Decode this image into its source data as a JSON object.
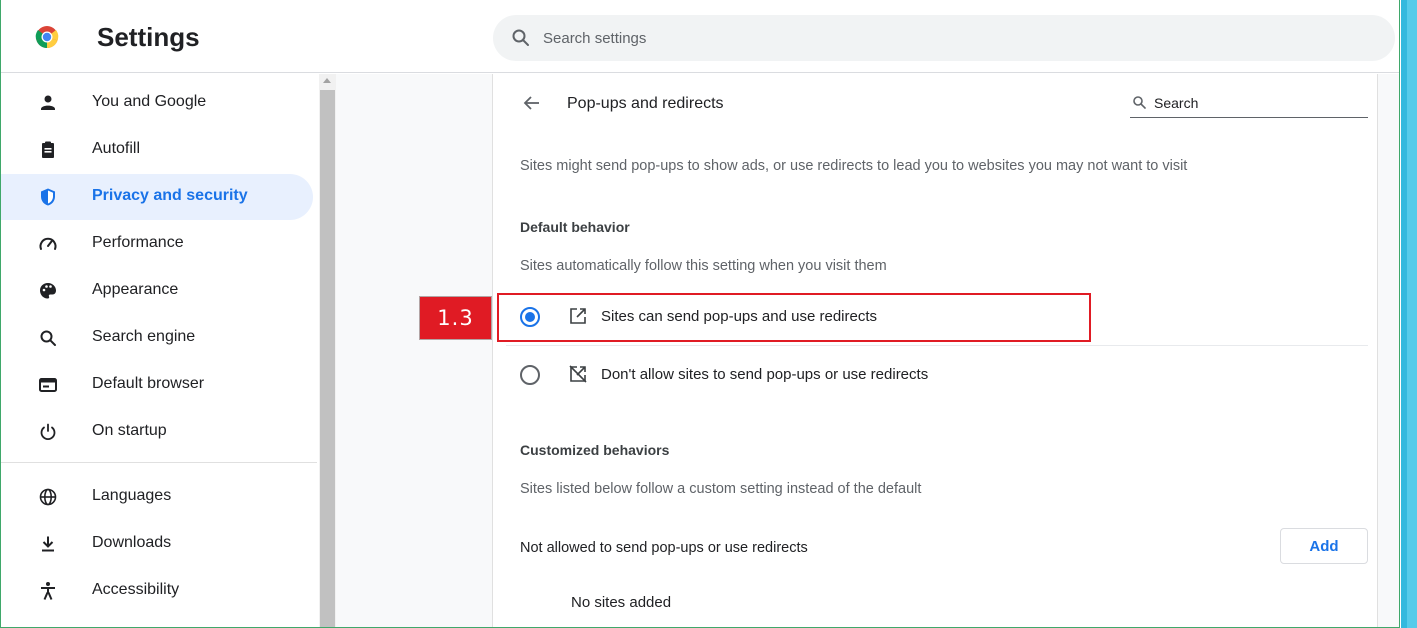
{
  "header": {
    "app_title": "Settings",
    "search_placeholder": "Search settings",
    "logo_icon": "chrome-logo-icon"
  },
  "sidebar": {
    "items": [
      {
        "label": "You and Google",
        "icon": "person-icon",
        "active": false
      },
      {
        "label": "Autofill",
        "icon": "clipboard-icon",
        "active": false
      },
      {
        "label": "Privacy and security",
        "icon": "shield-icon",
        "active": true
      },
      {
        "label": "Performance",
        "icon": "speedometer-icon",
        "active": false
      },
      {
        "label": "Appearance",
        "icon": "palette-icon",
        "active": false
      },
      {
        "label": "Search engine",
        "icon": "search-icon",
        "active": false
      },
      {
        "label": "Default browser",
        "icon": "browser-window-icon",
        "active": false
      },
      {
        "label": "On startup",
        "icon": "power-icon",
        "active": false
      },
      {
        "label": "Languages",
        "icon": "globe-icon",
        "active": false
      },
      {
        "label": "Downloads",
        "icon": "download-icon",
        "active": false
      },
      {
        "label": "Accessibility",
        "icon": "accessibility-icon",
        "active": false
      }
    ]
  },
  "page": {
    "title": "Pop-ups and redirects",
    "search_placeholder": "Search",
    "description": "Sites might send pop-ups to show ads, or use redirects to lead you to websites you may not want to visit",
    "default_section": {
      "title": "Default behavior",
      "subtitle": "Sites automatically follow this setting when you visit them",
      "options": [
        {
          "label": "Sites can send pop-ups and use redirects",
          "icon": "open-in-new-icon",
          "checked": true
        },
        {
          "label": "Don't allow sites to send pop-ups or use redirects",
          "icon": "popup-blocked-icon",
          "checked": false
        }
      ]
    },
    "custom_section": {
      "title": "Customized behaviors",
      "subtitle": "Sites listed below follow a custom setting instead of the default",
      "not_allowed_label": "Not allowed to send pop-ups or use redirects",
      "add_label": "Add",
      "empty_text": "No sites added"
    }
  },
  "annotation": {
    "step_label": "1.3",
    "highlight_color": "#e01b24"
  },
  "colors": {
    "accent": "#1a73e8",
    "active_nav_bg": "#e8f0fe",
    "annotation_red": "#e01b24"
  }
}
